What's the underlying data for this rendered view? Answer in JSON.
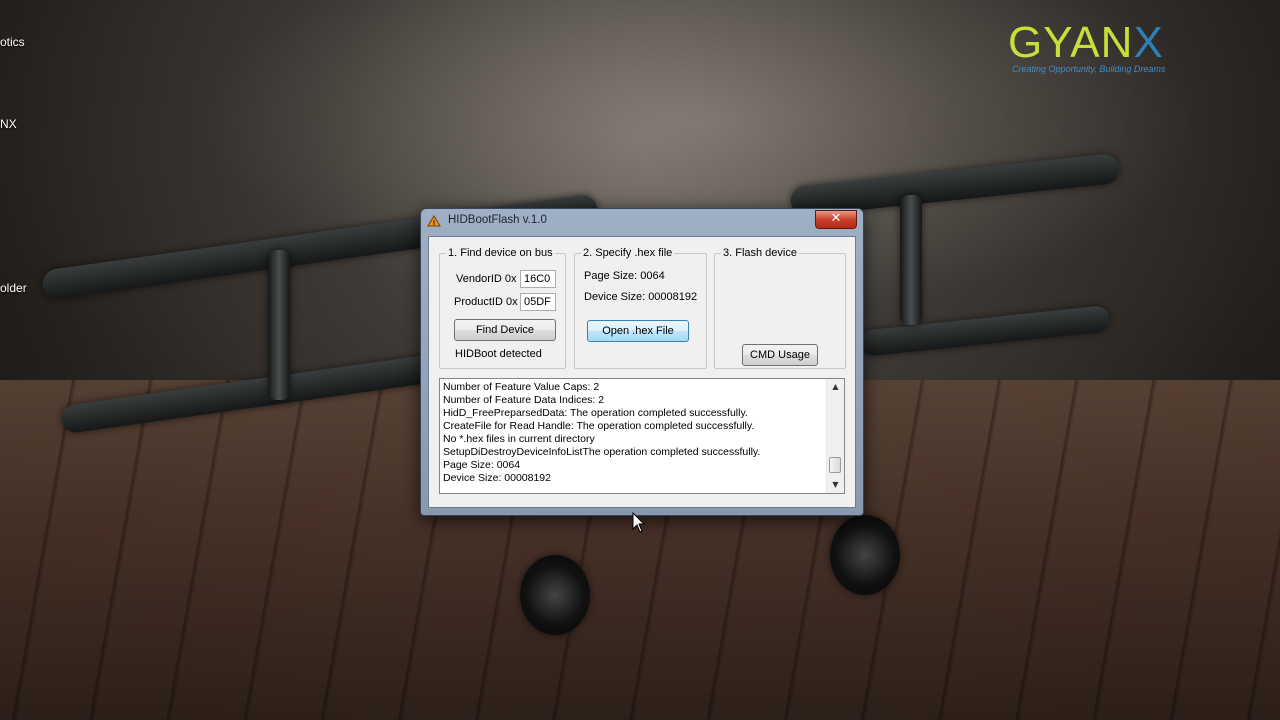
{
  "desktop": {
    "icon_labels": [
      "otics",
      "NX",
      "older"
    ]
  },
  "logo": {
    "brand_main": "GYAN",
    "brand_accent": "X",
    "tagline": "Creating Opportunity, Building Dreams"
  },
  "window": {
    "title": "HIDBootFlash v.1.0",
    "close_glyph": "✕",
    "groups": {
      "find": {
        "legend": "1. Find device on bus",
        "vendor_label": "VendorID 0x",
        "vendor_value": "16C0",
        "product_label": "ProductID 0x",
        "product_value": "05DF",
        "find_button": "Find Device",
        "status": "HIDBoot detected"
      },
      "hex": {
        "legend": "2. Specify .hex file",
        "page_size": "Page Size: 0064",
        "device_size": "Device Size: 00008192",
        "open_button": "Open .hex File"
      },
      "flash": {
        "legend": "3. Flash device",
        "cmd_button": "CMD Usage"
      }
    },
    "log_lines": [
      "Number of Feature Value Caps: 2",
      "Number of Feature Data Indices: 2",
      "HidD_FreePreparsedData: The operation completed successfully.",
      "CreateFile for Read Handle: The operation completed successfully.",
      "No *.hex files in current directory",
      "SetupDiDestroyDeviceInfoListThe operation completed successfully.",
      "Page Size: 0064",
      "Device Size: 00008192"
    ],
    "scroll_up_glyph": "▲",
    "scroll_down_glyph": "▼"
  },
  "colors": {
    "brand_green": "#c6e03b",
    "brand_blue": "#2e7fb8",
    "close_red": "#c8412b"
  }
}
